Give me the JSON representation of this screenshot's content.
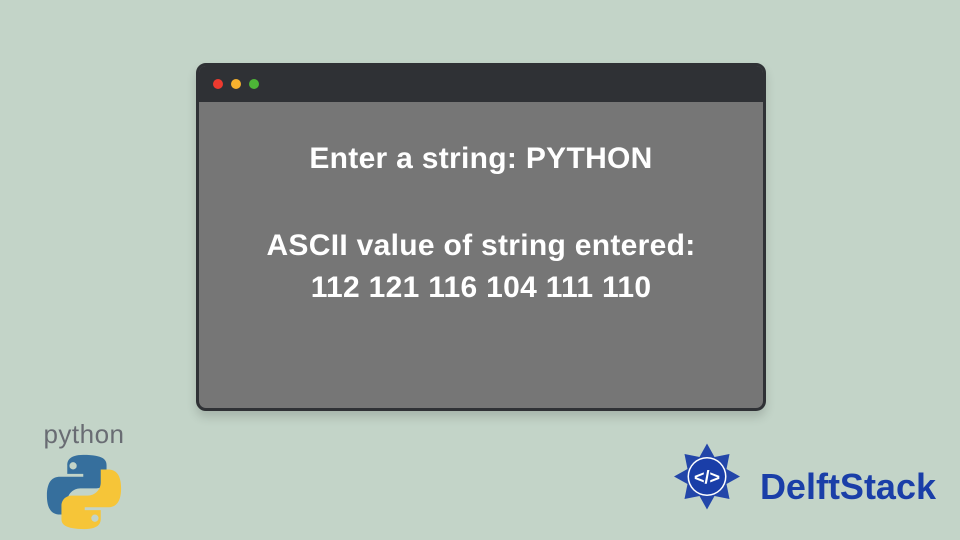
{
  "terminal": {
    "prompt_line": "Enter a string: PYTHON",
    "result_label": "ASCII value of string entered:",
    "result_values": "112 121 116 104 111 110"
  },
  "logos": {
    "python_label": "python",
    "delft_label": "DelftStack"
  },
  "colors": {
    "page_bg": "#c3d4c8",
    "window_bg": "#767676",
    "window_border": "#2f3135",
    "dot_red": "#ed3a2f",
    "dot_yellow": "#f6b12e",
    "dot_green": "#4db537",
    "delft_blue": "#1a3ea8",
    "python_text": "#696c73",
    "python_blue": "#366f9d",
    "python_yellow": "#f6c538"
  }
}
